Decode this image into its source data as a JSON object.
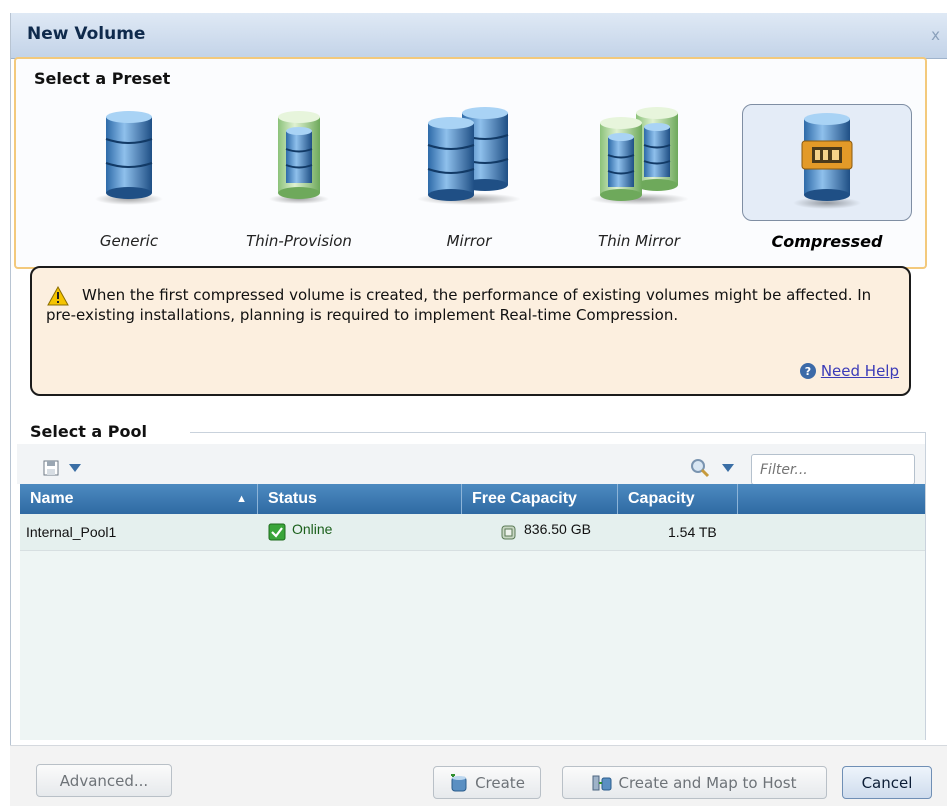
{
  "dialog": {
    "title": "New Volume",
    "close_label": "x"
  },
  "presets": {
    "title": "Select a Preset",
    "items": [
      {
        "label": "Generic",
        "icon": "generic-db-icon",
        "selected": false
      },
      {
        "label": "Thin-Provision",
        "icon": "thin-provision-db-icon",
        "selected": false
      },
      {
        "label": "Mirror",
        "icon": "mirror-db-icon",
        "selected": false
      },
      {
        "label": "Thin Mirror",
        "icon": "thin-mirror-db-icon",
        "selected": false
      },
      {
        "label": "Compressed",
        "icon": "compressed-db-icon",
        "selected": true
      }
    ]
  },
  "warning": {
    "text": "When the first compressed volume is created, the performance of existing volumes might be affected. In pre-existing installations, planning is required to implement Real-time Compression.",
    "help_label": "Need Help"
  },
  "pool": {
    "title": "Select a Pool",
    "filter_placeholder": "Filter...",
    "columns": {
      "name": "Name",
      "status": "Status",
      "free_capacity": "Free Capacity",
      "capacity": "Capacity"
    },
    "sort_indicator": "▲",
    "rows": [
      {
        "name": "Internal_Pool1",
        "status": "Online",
        "free_capacity": "836.50 GB",
        "capacity": "1.54 TB"
      }
    ]
  },
  "footer": {
    "advanced_label": "Advanced...",
    "create_label": "Create",
    "create_map_label": "Create and Map to Host",
    "cancel_label": "Cancel"
  },
  "colors": {
    "header_blue": "#3a77b0",
    "warning_bg": "#fcefdf",
    "preset_border": "#f3c97c",
    "online_green": "#2e8b2e"
  }
}
